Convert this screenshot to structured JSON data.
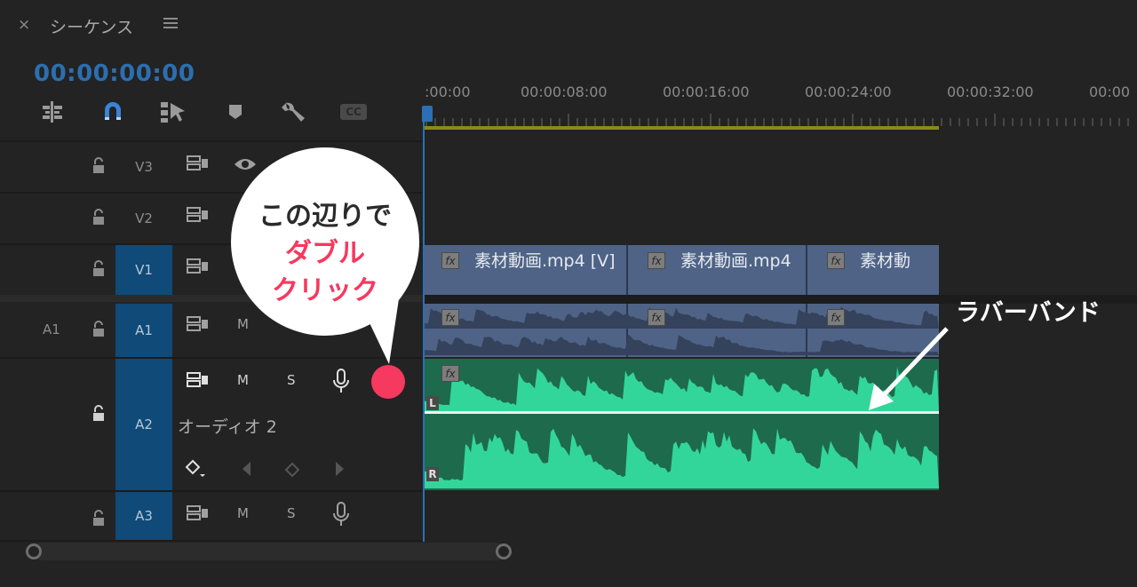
{
  "panel": {
    "close_label": "×",
    "title": "シーケンス",
    "timecode": "00:00:00:00"
  },
  "toolbar": {
    "tools": [
      {
        "name": "insert-nest-icon"
      },
      {
        "name": "snap-magnet-icon"
      },
      {
        "name": "linked-selection-icon"
      },
      {
        "name": "add-marker-icon"
      },
      {
        "name": "wrench-settings-icon"
      },
      {
        "name": "captions-icon",
        "label": "CC"
      }
    ]
  },
  "ruler": {
    "labels": [
      ":00:00",
      "00:00:08:00",
      "00:00:16:00",
      "00:00:24:00",
      "00:00:32:00",
      "00:00"
    ]
  },
  "tracks": {
    "V3": {
      "label": "V3"
    },
    "V2": {
      "label": "V2"
    },
    "V1": {
      "label": "V1"
    },
    "A1": {
      "source_label": "A1",
      "label": "A1",
      "mute": "M"
    },
    "A2": {
      "label": "A2",
      "mute": "M",
      "solo": "S",
      "name": "オーディオ 2"
    },
    "A3": {
      "label": "A3",
      "mute": "M",
      "solo": "S"
    }
  },
  "clips": {
    "video": [
      {
        "name": "素材動画.mp4 [V]"
      },
      {
        "name": "素材動画.mp4"
      },
      {
        "name": "素材動"
      }
    ],
    "fx_label": "fx",
    "channel_left": "L",
    "channel_right": "R"
  },
  "annotations": {
    "bubble_line1": "この辺りで",
    "bubble_line2": "ダブル",
    "bubble_line3": "クリック",
    "rubber_band_label": "ラバーバンド",
    "accent_color": "#f5395f"
  },
  "colors": {
    "selected_track": "#0f4a78",
    "video_clip": "#4e6386",
    "audio_clip": "#1e6a4d",
    "waveform": "#33d69a",
    "playhead": "#2c6fb5",
    "work_area": "#8b8a18"
  }
}
